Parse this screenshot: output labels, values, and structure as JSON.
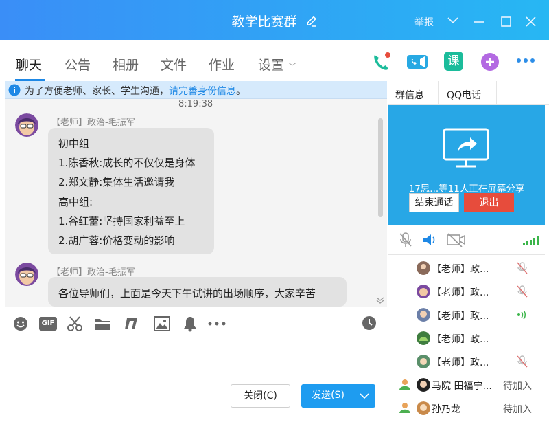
{
  "window": {
    "title": "教学比赛群",
    "report": "举报"
  },
  "tabs": [
    {
      "label": "聊天",
      "active": true
    },
    {
      "label": "公告"
    },
    {
      "label": "相册"
    },
    {
      "label": "文件"
    },
    {
      "label": "作业"
    },
    {
      "label": "设置"
    }
  ],
  "toolbar_icons": [
    "phone-icon",
    "video-icon",
    "class-icon",
    "add-app-icon",
    "more-icon"
  ],
  "toolbar_class_label": "课",
  "notice": {
    "text": "为了方便老师、家长、学生沟通，",
    "link": "请完善身份信息",
    "suffix": "。"
  },
  "chat": {
    "timestamp": "8:19:38",
    "messages": [
      {
        "sender": "【老师】政治-毛振军",
        "lines": [
          "初中组",
          "1.陈香秋:成长的不仅仅是身体",
          "2.郑文静:集体生活邀请我",
          "高中组:",
          "1.谷红蕾:坚持国家利益至上",
          "2.胡广蓉:价格变动的影响"
        ]
      },
      {
        "sender": "【老师】政治-毛振军",
        "lines": [
          "各位导师们，上面是今天下午试讲的出场顺序，大家辛苦"
        ]
      }
    ]
  },
  "input": {
    "gif_label": "GIF",
    "close_label": "关闭(C)",
    "send_label": "发送(S)"
  },
  "right_panel": {
    "tabs": [
      "群信息",
      "QQ电话"
    ],
    "share_text": "17思...等11人正在屏幕分享",
    "end_call": "结束通话",
    "exit": "退出",
    "members": [
      {
        "name": "【老师】政...",
        "status_icon": "mic-muted-icon"
      },
      {
        "name": "【老师】政...",
        "status_icon": "mic-muted-icon"
      },
      {
        "name": "【老师】政...",
        "status_icon": "speaking-icon"
      },
      {
        "name": "【老师】政...",
        "status_icon": ""
      },
      {
        "name": "【老师】政...",
        "status_icon": "mic-muted-icon"
      },
      {
        "name": "马院 田福宁...",
        "status": "待加入"
      },
      {
        "name": "孙乃龙",
        "status": "待加入"
      }
    ]
  },
  "colors": {
    "title_bar_start": "#3a8ef7",
    "title_bar_end": "#27b7f3",
    "accent": "#1e88e5",
    "share_bg": "#28a7e6",
    "exit_red": "#e74c3c",
    "send_blue": "#1e9cf0"
  }
}
